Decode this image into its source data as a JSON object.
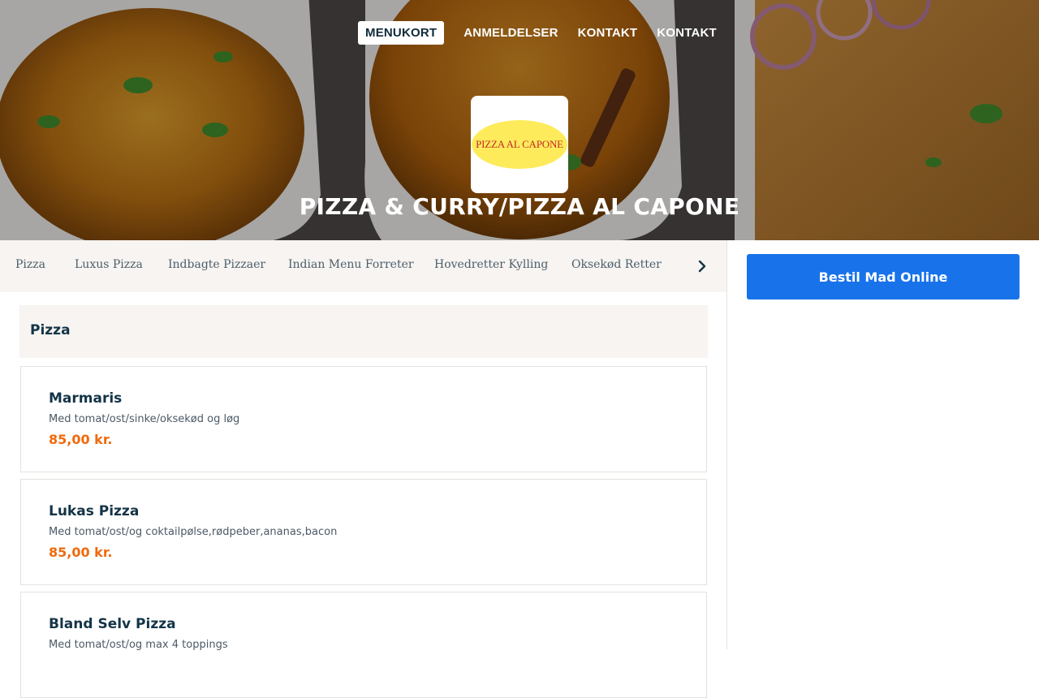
{
  "nav": {
    "items": [
      {
        "label": "MENUKORT",
        "active": true
      },
      {
        "label": "ANMELDELSER",
        "active": false
      },
      {
        "label": "KONTAKT",
        "active": false
      },
      {
        "label": "KONTAKT",
        "active": false
      }
    ]
  },
  "restaurant": {
    "logo_text": "PIZZA AL CAPONE",
    "title": "PIZZA & CURRY/PIZZA AL CAPONE"
  },
  "categories": {
    "items": [
      "Pizza",
      "Luxus Pizza",
      "Indbagte Pizzaer",
      "Indian Menu Forreter",
      "Hovedretter Kylling",
      "Oksekød Retter"
    ],
    "next_icon": "chevron-right-icon"
  },
  "order": {
    "button_label": "Bestil Mad Online"
  },
  "menu": {
    "section_title": "Pizza",
    "items": [
      {
        "name": "Marmaris",
        "description": "Med tomat/ost/sinke/oksekød og løg",
        "price": "85,00 kr."
      },
      {
        "name": "Lukas Pizza",
        "description": "Med tomat/ost/og coktailpølse,rødpeber,ananas,bacon",
        "price": "85,00 kr."
      },
      {
        "name": "Bland Selv Pizza",
        "description": "Med tomat/ost/og max 4 toppings",
        "price": ""
      }
    ]
  },
  "colors": {
    "accent": "#1873ea",
    "price": "#ee6a0d",
    "heading": "#143447",
    "panel_bg": "#f7f4f1",
    "logo_yellow": "#fdeb5b",
    "logo_red": "#c62a26"
  }
}
